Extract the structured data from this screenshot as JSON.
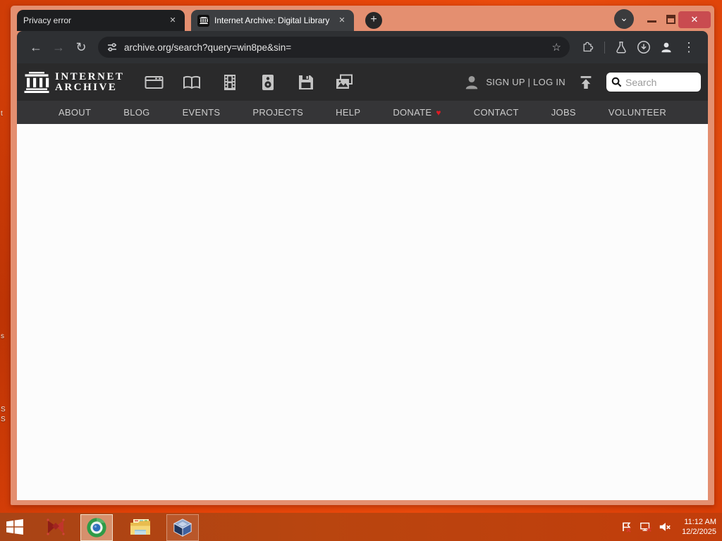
{
  "colors": {
    "wallpaper_accent": "#e2430a",
    "window_frame": "#e48f70",
    "close_button": "#c94b50",
    "donate_heart": "#e01b24",
    "toolbar_bg": "#2e3033",
    "archive_header_bg": "#2a2a2b",
    "archive_nav_bg": "#353537",
    "active_tab_bg": "#3c3e41",
    "inactive_tab_bg": "#1d1e20"
  },
  "icons": {
    "new_tab": "+",
    "back": "←",
    "forward": "→",
    "reload": "↻",
    "bookmark_star": "☆",
    "overflow_menu": "⋮",
    "tab_close": "✕",
    "window_close": "✕",
    "tab_search_chevron": "⌄",
    "heart": "♥"
  },
  "browser": {
    "tabs": [
      {
        "title": "Privacy error"
      },
      {
        "title": "Internet Archive: Digital Library"
      }
    ],
    "url": "archive.org/search?query=win8pe&sin="
  },
  "archive": {
    "logo_line1": "INTERNET",
    "logo_line2": "ARCHIVE",
    "account_text": "SIGN UP | LOG IN",
    "search_placeholder": "Search",
    "media_types": [
      "web",
      "texts",
      "video",
      "audio",
      "software",
      "images"
    ],
    "nav_items": [
      {
        "label": "ABOUT"
      },
      {
        "label": "BLOG"
      },
      {
        "label": "EVENTS"
      },
      {
        "label": "PROJECTS"
      },
      {
        "label": "HELP"
      },
      {
        "label": "DONATE"
      },
      {
        "label": "CONTACT"
      },
      {
        "label": "JOBS"
      },
      {
        "label": "VOLUNTEER"
      }
    ]
  },
  "taskbar": {
    "time": "11:12 AM",
    "date": "12/2/2025"
  },
  "desktop": {
    "fragments": [
      {
        "text": "t"
      },
      {
        "text": "s"
      },
      {
        "text": "S"
      },
      {
        "text": "S"
      }
    ]
  }
}
